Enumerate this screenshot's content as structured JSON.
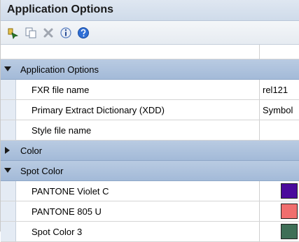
{
  "window": {
    "title": "Application Options"
  },
  "toolbar": {
    "buttons": [
      {
        "icon": "add-item-icon"
      },
      {
        "icon": "copy-icon"
      },
      {
        "icon": "delete-icon"
      },
      {
        "icon": "info-icon"
      },
      {
        "icon": "help-icon"
      }
    ]
  },
  "categories": {
    "application_options": {
      "label": "Application Options",
      "expanded": true
    },
    "color": {
      "label": "Color",
      "expanded": false
    },
    "spot_color": {
      "label": "Spot Color",
      "expanded": true
    }
  },
  "properties": {
    "fxr_file_name": {
      "name": "FXR file name",
      "value": "rel121"
    },
    "primary_extract_dictionary": {
      "name": "Primary Extract Dictionary (XDD)",
      "value": "Symbol"
    },
    "style_file_name": {
      "name": "Style file name",
      "value": ""
    },
    "pantone_violet_c": {
      "name": "PANTONE Violet C",
      "color": "#4a0a9c"
    },
    "pantone_805_u": {
      "name": "PANTONE 805 U",
      "color": "#f06e6e"
    },
    "spot_color_3": {
      "name": "Spot Color 3",
      "color": "#3f6f57"
    }
  }
}
